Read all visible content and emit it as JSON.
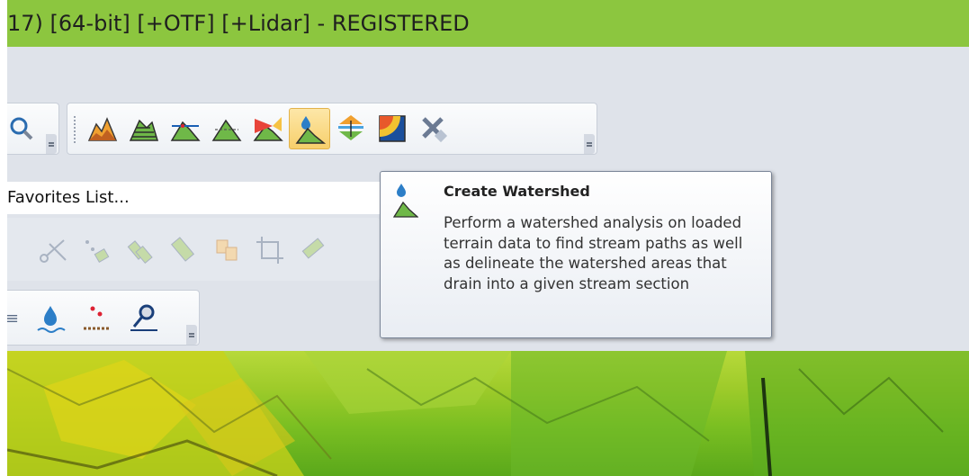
{
  "window": {
    "title": "17) [64-bit] [+OTF] [+Lidar] - REGISTERED"
  },
  "favorites": {
    "label": "Favorites List..."
  },
  "toolbar_terrain": {
    "buttons": [
      {
        "name": "terrain-profile-icon"
      },
      {
        "name": "contour-generation-icon"
      },
      {
        "name": "line-of-sight-icon"
      },
      {
        "name": "terrain-slope-icon"
      },
      {
        "name": "view-shed-icon"
      },
      {
        "name": "create-watershed-icon",
        "active": true
      },
      {
        "name": "combine-terrain-icon"
      },
      {
        "name": "density-grid-icon"
      },
      {
        "name": "remove-tool-icon"
      }
    ]
  },
  "tooltip": {
    "title": "Create Watershed",
    "body": "Perform a watershed analysis on loaded terrain data to find stream paths as well as delineate the watershed areas that drain into a given stream section"
  },
  "colors": {
    "titlebar": "#8cc63f",
    "toolbar_bg": "#dfe3ea",
    "active_button": "#f7cf6b",
    "map_green": "#7bbf22",
    "map_yellow": "#c9d11a"
  }
}
